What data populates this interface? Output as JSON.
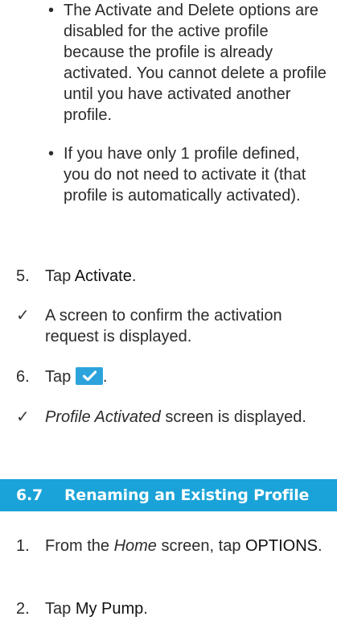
{
  "bullets": [
    {
      "text": "The Activate and Delete options are disabled for the active profile because the profile is already activated. You cannot delete a profile until you have activated another profile."
    },
    {
      "text": "If you have only 1 profile defined, you do not need to activate it (that profile is automatically activated)."
    }
  ],
  "step5": {
    "num": "5.",
    "prefix": "Tap ",
    "action": "Activate",
    "suffix": "."
  },
  "result1": {
    "mark": "✓",
    "text": "A screen to confirm the activation request is displayed."
  },
  "step6": {
    "num": "6.",
    "prefix": "Tap ",
    "suffix": ".",
    "button_icon": "checkmark-icon",
    "button_color": "#2da3dc"
  },
  "result2": {
    "mark": "✓",
    "italic": "Profile Activated",
    "text": " screen is displayed."
  },
  "section": {
    "number": "6.7",
    "title": "Renaming an Existing Profile",
    "color": "#1aa3d8"
  },
  "step1": {
    "num": "1.",
    "prefix": "From the ",
    "italic": "Home",
    "middle": " screen, tap ",
    "action": "OPTIONS",
    "suffix": "."
  },
  "step2": {
    "num": "2.",
    "prefix": "Tap ",
    "action": "My Pump",
    "suffix": "."
  }
}
